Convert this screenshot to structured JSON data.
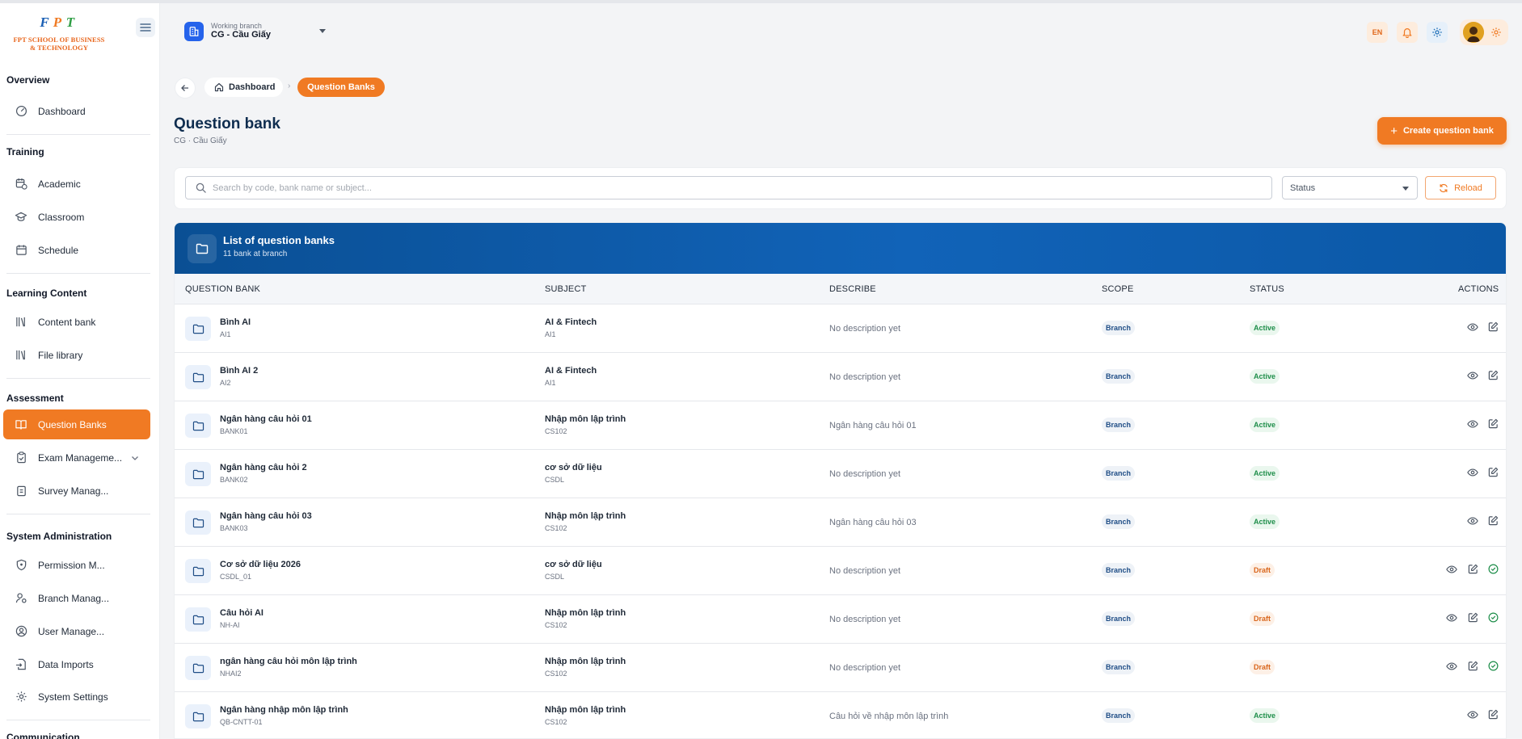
{
  "brand": {
    "logo_letters": [
      "F",
      "P",
      "T"
    ],
    "logo_line1": "FPT SCHOOL OF BUSINESS",
    "logo_line2": "& TECHNOLOGY",
    "colors": {
      "orange": "#f07a23",
      "blue": "#0a4f94",
      "green": "#1e8e4a"
    }
  },
  "sidebar": {
    "sections": [
      {
        "title": "Overview",
        "items": [
          {
            "label": "Dashboard",
            "icon": "gauge-icon"
          }
        ]
      },
      {
        "title": "Training",
        "items": [
          {
            "label": "Academic",
            "icon": "calendar-clock-icon"
          },
          {
            "label": "Classroom",
            "icon": "graduation-cap-icon"
          },
          {
            "label": "Schedule",
            "icon": "calendar-icon"
          }
        ]
      },
      {
        "title": "Learning Content",
        "items": [
          {
            "label": "Content bank",
            "icon": "library-icon"
          },
          {
            "label": "File library",
            "icon": "library-icon"
          }
        ]
      },
      {
        "title": "Assessment",
        "items": [
          {
            "label": "Question Banks",
            "icon": "book-open-icon",
            "active": true
          },
          {
            "label": "Exam Manageme...",
            "icon": "clipboard-check-icon"
          },
          {
            "label": "Survey Manag...",
            "icon": "clipboard-list-icon"
          }
        ]
      },
      {
        "title": "System Administration",
        "items": [
          {
            "label": "Permission M...",
            "icon": "shield-icon"
          },
          {
            "label": "Branch Manag...",
            "icon": "users-cog-icon"
          },
          {
            "label": "User Manage...",
            "icon": "user-circle-icon"
          },
          {
            "label": "Data Imports",
            "icon": "file-import-icon"
          },
          {
            "label": "System Settings",
            "icon": "gear-icon"
          }
        ]
      },
      {
        "title": "Communication",
        "items": []
      }
    ]
  },
  "header": {
    "branch_label": "Working branch",
    "branch_name": "CG - Cầu Giấy",
    "language": "EN"
  },
  "breadcrumb": {
    "home": "Dashboard",
    "current": "Question Banks"
  },
  "page": {
    "title": "Question bank",
    "subtitle": "CG · Cầu Giấy",
    "create_button": "Create question bank"
  },
  "filters": {
    "search_placeholder": "Search by code, bank name or subject...",
    "status_placeholder": "Status",
    "reload_label": "Reload"
  },
  "list": {
    "title": "List of question banks",
    "subtitle": "11 bank at branch",
    "columns": [
      "QUESTION BANK",
      "SUBJECT",
      "DESCRIBE",
      "SCOPE",
      "STATUS",
      "ACTIONS"
    ],
    "rows": [
      {
        "name": "Bình AI",
        "code": "AI1",
        "subject": "AI & Fintech",
        "subject_code": "AI1",
        "describe": "No description yet",
        "scope": "Branch",
        "status": "Active"
      },
      {
        "name": "Bình AI 2",
        "code": "AI2",
        "subject": "AI & Fintech",
        "subject_code": "AI1",
        "describe": "No description yet",
        "scope": "Branch",
        "status": "Active"
      },
      {
        "name": "Ngân hàng câu hỏi 01",
        "code": "BANK01",
        "subject": "Nhập môn lập trình",
        "subject_code": "CS102",
        "describe": "Ngân hàng câu hỏi 01",
        "scope": "Branch",
        "status": "Active"
      },
      {
        "name": "Ngân hàng câu hỏi 2",
        "code": "BANK02",
        "subject": "cơ sở dữ liệu",
        "subject_code": "CSDL",
        "describe": "No description yet",
        "scope": "Branch",
        "status": "Active"
      },
      {
        "name": "Ngân hàng câu hỏi 03",
        "code": "BANK03",
        "subject": "Nhập môn lập trình",
        "subject_code": "CS102",
        "describe": "Ngân hàng câu hỏi 03",
        "scope": "Branch",
        "status": "Active"
      },
      {
        "name": "Cơ sở dữ liệu 2026",
        "code": "CSDL_01",
        "subject": "cơ sở dữ liệu",
        "subject_code": "CSDL",
        "describe": "No description yet",
        "scope": "Branch",
        "status": "Draft"
      },
      {
        "name": "Câu hỏi AI",
        "code": "NH-AI",
        "subject": "Nhập môn lập trình",
        "subject_code": "CS102",
        "describe": "No description yet",
        "scope": "Branch",
        "status": "Draft"
      },
      {
        "name": "ngân hàng câu hỏi môn lập trình",
        "code": "NHAI2",
        "subject": "Nhập môn lập trình",
        "subject_code": "CS102",
        "describe": "No description yet",
        "scope": "Branch",
        "status": "Draft"
      },
      {
        "name": "Ngân hàng nhập môn lập trình",
        "code": "QB-CNTT-01",
        "subject": "Nhập môn lập trình",
        "subject_code": "CS102",
        "describe": "Câu hỏi về nhập môn lập trình",
        "scope": "Branch",
        "status": "Active"
      }
    ]
  }
}
